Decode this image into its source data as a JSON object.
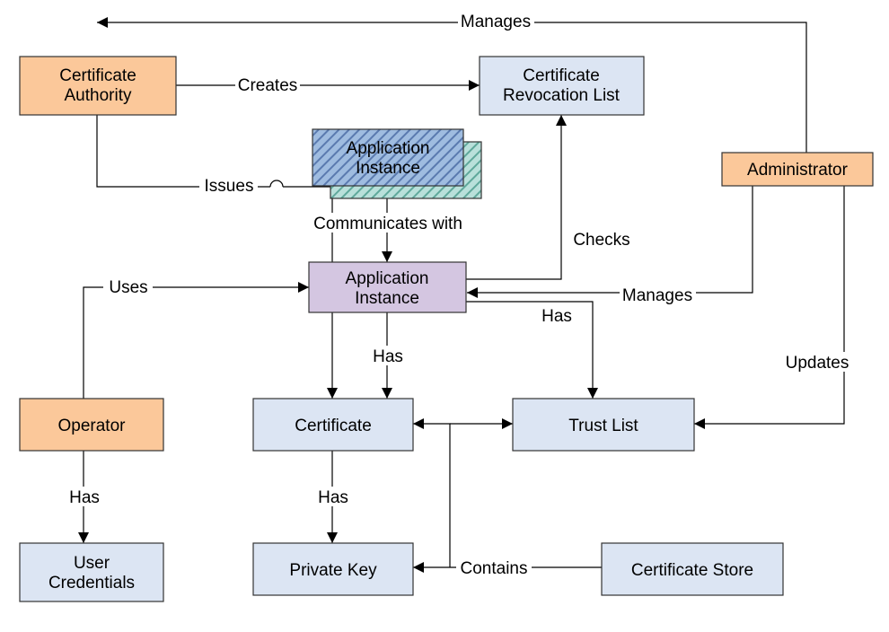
{
  "diagram": {
    "nodes": {
      "certificateAuthority": {
        "line1": "Certificate",
        "line2": "Authority"
      },
      "certificateRevocationList": {
        "line1": "Certificate",
        "line2": "Revocation List"
      },
      "administrator": "Administrator",
      "applicationInstanceRemote": {
        "line1": "Application",
        "line2": "Instance"
      },
      "applicationInstance": {
        "line1": "Application",
        "line2": "Instance"
      },
      "operator": "Operator",
      "certificate": "Certificate",
      "trustList": "Trust List",
      "userCredentials": {
        "line1": "User",
        "line2": "Credentials"
      },
      "privateKey": "Private Key",
      "certificateStore": "Certificate Store"
    },
    "edges": {
      "manages1": "Manages",
      "creates": "Creates",
      "issues": "Issues",
      "communicatesWith": "Communicates with",
      "checks": "Checks",
      "manages2": "Manages",
      "uses": "Uses",
      "has1": "Has",
      "has2": "Has",
      "updates": "Updates",
      "has3": "Has",
      "has4": "Has",
      "contains": "Contains"
    }
  }
}
